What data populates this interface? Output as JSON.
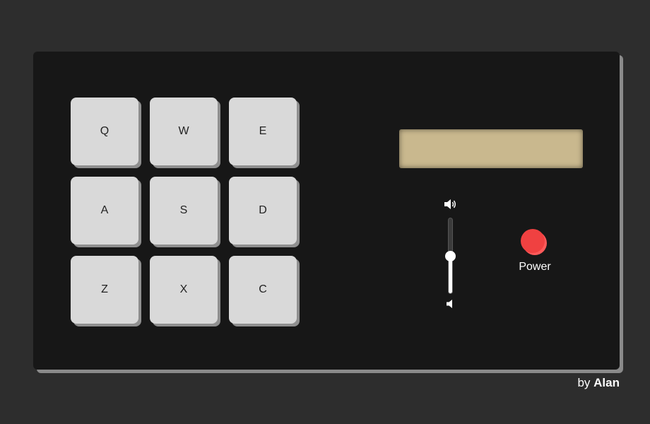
{
  "keys": [
    "Q",
    "W",
    "E",
    "A",
    "S",
    "D",
    "Z",
    "X",
    "C"
  ],
  "display": {
    "text": ""
  },
  "volume": {
    "level": 0.5,
    "up_icon": "volume-up-icon",
    "down_icon": "volume-down-icon"
  },
  "power": {
    "label": "Power",
    "color": "#f04141"
  },
  "credit": {
    "prefix": "by",
    "author": "Alan"
  },
  "colors": {
    "background": "#2d2d2d",
    "machine": "#171717",
    "key": "#d9d9d9",
    "display": "#c9b88e"
  }
}
